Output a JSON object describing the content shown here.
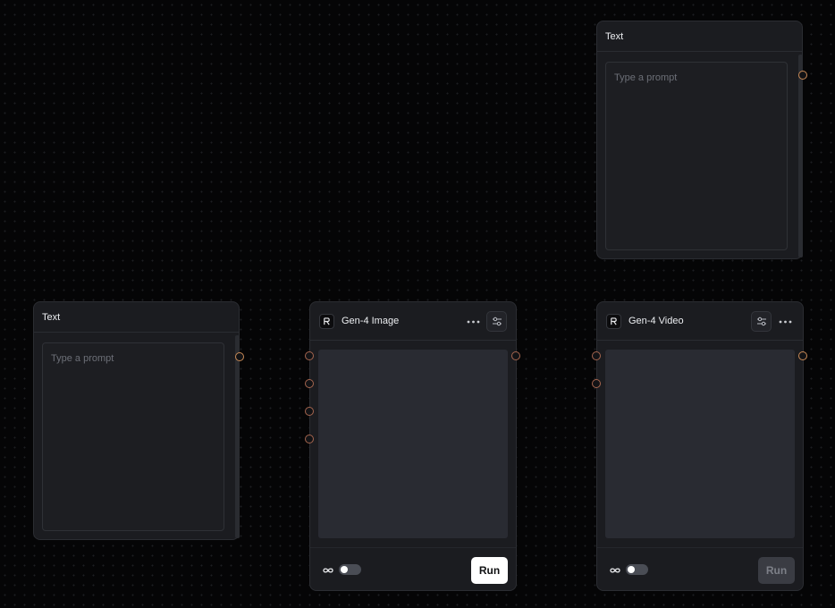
{
  "text_nodes": [
    {
      "title": "Text",
      "prompt_placeholder": "Type a prompt"
    },
    {
      "title": "Text",
      "prompt_placeholder": "Type a prompt"
    }
  ],
  "image_node": {
    "title": "Gen-4 Image",
    "icon": "runway-logo-icon",
    "menu_icon": "more-horizontal-icon",
    "settings_icon": "sliders-icon",
    "loop_icon": "infinity-icon",
    "loop_enabled": false,
    "run_label": "Run",
    "run_enabled": true
  },
  "video_node": {
    "title": "Gen-4 Video",
    "icon": "runway-logo-icon",
    "menu_icon": "more-horizontal-icon",
    "settings_icon": "sliders-icon",
    "loop_icon": "infinity-icon",
    "loop_enabled": false,
    "run_label": "Run",
    "run_enabled": false
  },
  "colors": {
    "canvas_bg": "#050506",
    "node_bg": "#1b1c20",
    "port_outline": "#c98a56",
    "run_enabled_bg": "#ffffff",
    "run_disabled_bg": "#3a3c43"
  }
}
